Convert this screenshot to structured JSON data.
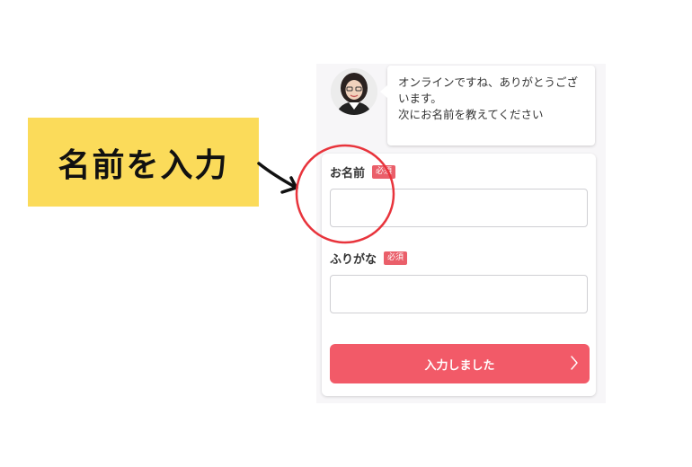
{
  "callout": {
    "text": "名前を入力"
  },
  "chat": {
    "message_line1": "オンラインですね、ありがとうござ",
    "message_line2": "います。",
    "message_line3": "次にお名前を教えてください"
  },
  "form": {
    "name_label": "お名前",
    "name_required": "必須",
    "name_value": "",
    "furigana_label": "ふりがな",
    "furigana_required": "必須",
    "furigana_value": "",
    "submit_label": "入力しました"
  },
  "colors": {
    "callout_bg": "#fbdb5a",
    "accent": "#f25a68",
    "badge": "#ea5f6a",
    "annotation": "#e8343c"
  },
  "icons": {
    "arrow": "hand-drawn-arrow-icon",
    "submit": "chevron-right-icon"
  }
}
